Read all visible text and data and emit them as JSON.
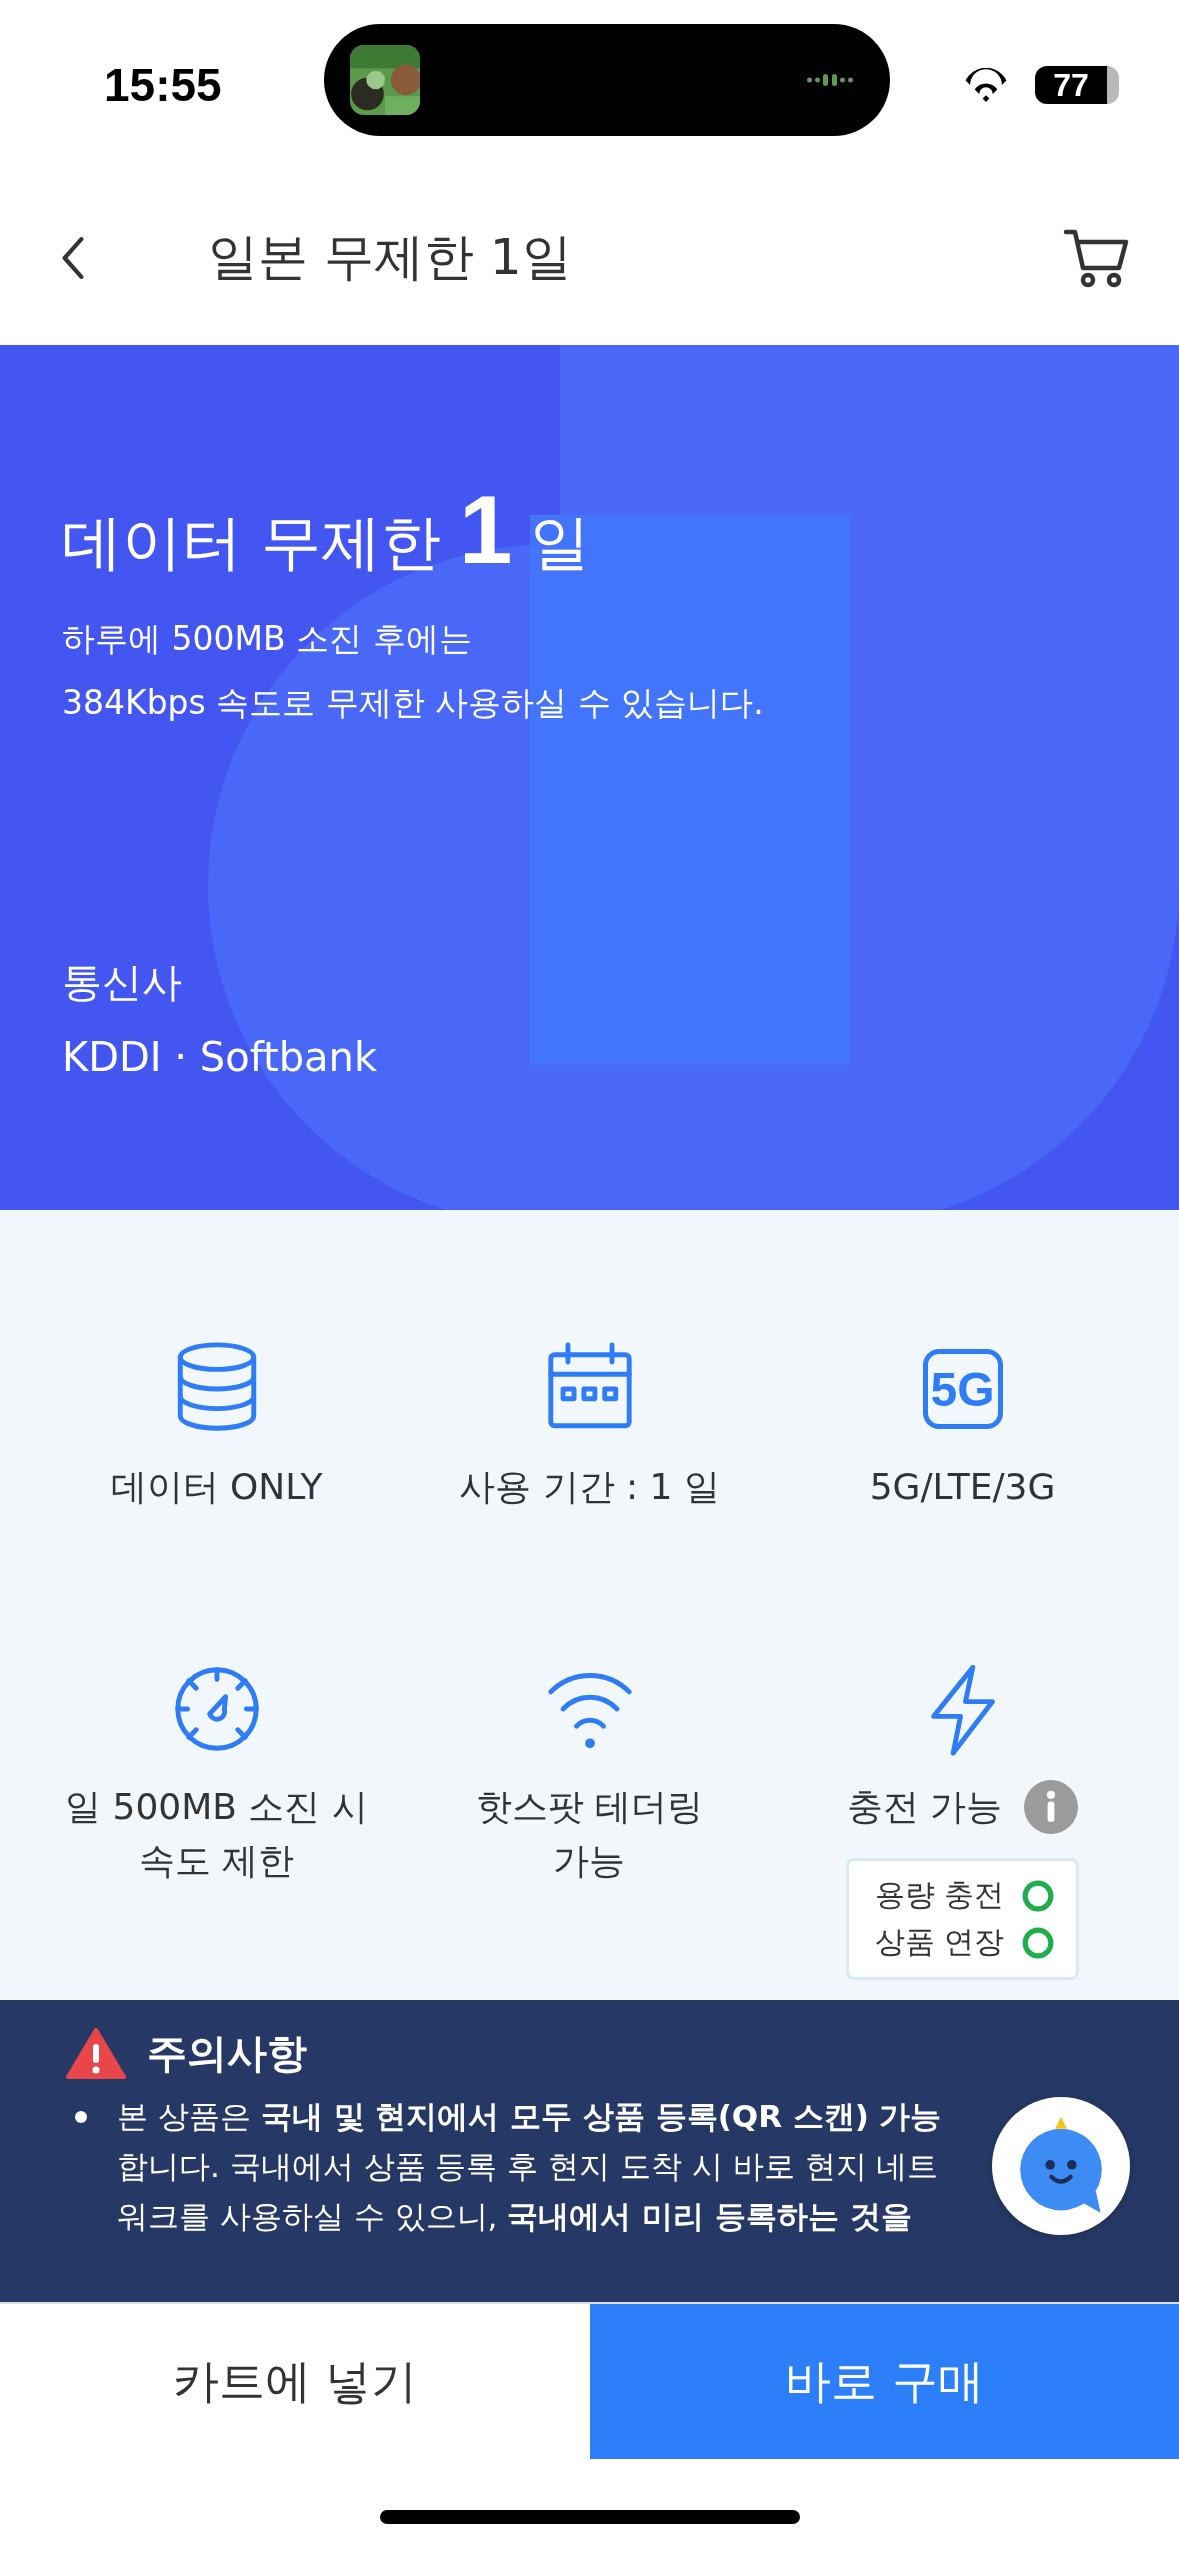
{
  "status_bar": {
    "time": "15:55",
    "battery": "77"
  },
  "header": {
    "title": "일본 무제한 1일"
  },
  "hero": {
    "title_prefix": "데이터 무제한",
    "title_number": "1",
    "title_suffix": "일",
    "description": [
      "하루에 500MB 소진 후에는",
      "384Kbps 속도로 무제한 사용하실 수 있습니다."
    ],
    "carrier_label": "통신사",
    "carrier_value": "KDDI · Softbank"
  },
  "features": [
    {
      "kind": "database",
      "label": [
        "데이터 ONLY"
      ]
    },
    {
      "kind": "calendar",
      "label": [
        "사용 기간 : 1 일"
      ]
    },
    {
      "kind": "badge",
      "badge_text": "5G",
      "label": [
        "5G/LTE/3G"
      ]
    },
    {
      "kind": "gauge",
      "label": [
        "일 500MB 소진 시",
        "속도 제한"
      ]
    },
    {
      "kind": "wifi",
      "label": [
        "핫스팟 테더링",
        "가능"
      ]
    },
    {
      "kind": "bolt",
      "label": [
        "충전 가능"
      ],
      "info": true,
      "options": [
        {
          "label": "용량 충전",
          "available": true
        },
        {
          "label": "상품 연장",
          "available": true
        }
      ]
    }
  ],
  "notice": {
    "title": "주의사항",
    "items": [
      "본 상품은 **국내 및 현지에서 모두 상품 등록(QR 스캔)** **가능**합니다. 국내에서 상품 등록 후 현지 도착 시 바로 현지 네트워크를 사용하실 수 있으니, **국내에서 미리 등록하는 것을**"
    ]
  },
  "buttons": {
    "cart": "카트에 넣기",
    "buy": "바로 구매"
  }
}
